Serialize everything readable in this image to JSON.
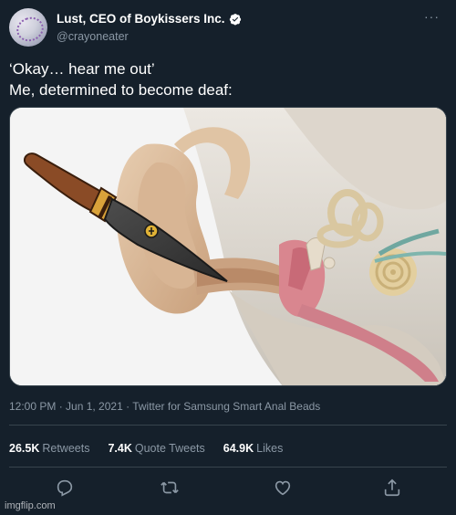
{
  "tweet": {
    "author": {
      "display_name": "Lust, CEO of Boykissers Inc.",
      "handle": "@crayoneater",
      "verified": true
    },
    "more_label": "···",
    "text_lines": [
      "‘Okay… hear me out’",
      "Me, determined to become deaf:"
    ],
    "meta": "12:00 PM · Jun 1, 2021 · Twitter for Samsung Smart Anal Beads",
    "stats": {
      "retweets": {
        "count": "26.5K",
        "label": "Retweets"
      },
      "quote_tweets": {
        "count": "7.4K",
        "label": "Quote Tweets"
      },
      "likes": {
        "count": "64.9K",
        "label": "Likes"
      }
    },
    "actions": [
      "reply-icon",
      "retweet-icon",
      "like-icon",
      "share-icon"
    ]
  },
  "watermark": "imgflip.com",
  "colors": {
    "background": "#15202b",
    "text_primary": "#ffffff",
    "text_secondary": "#8b98a5",
    "divider": "#38444d",
    "verified": "#ffffff"
  }
}
